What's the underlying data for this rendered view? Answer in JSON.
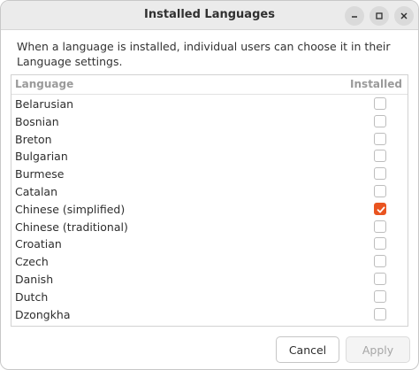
{
  "window": {
    "title": "Installed Languages",
    "controls": [
      "minimize-icon",
      "maximize-icon",
      "close-icon"
    ]
  },
  "description": "When a language is installed, individual users can choose it in their Language settings.",
  "list": {
    "headers": {
      "language": "Language",
      "installed": "Installed"
    },
    "rows": [
      {
        "name": "Belarusian",
        "installed": false
      },
      {
        "name": "Bosnian",
        "installed": false
      },
      {
        "name": "Breton",
        "installed": false
      },
      {
        "name": "Bulgarian",
        "installed": false
      },
      {
        "name": "Burmese",
        "installed": false
      },
      {
        "name": "Catalan",
        "installed": false
      },
      {
        "name": "Chinese (simplified)",
        "installed": true
      },
      {
        "name": "Chinese (traditional)",
        "installed": false
      },
      {
        "name": "Croatian",
        "installed": false
      },
      {
        "name": "Czech",
        "installed": false
      },
      {
        "name": "Danish",
        "installed": false
      },
      {
        "name": "Dutch",
        "installed": false
      },
      {
        "name": "Dzongkha",
        "installed": false
      }
    ]
  },
  "buttons": {
    "cancel": "Cancel",
    "apply": "Apply"
  },
  "colors": {
    "accent": "#e95420",
    "titlebar": "#ebebeb"
  }
}
